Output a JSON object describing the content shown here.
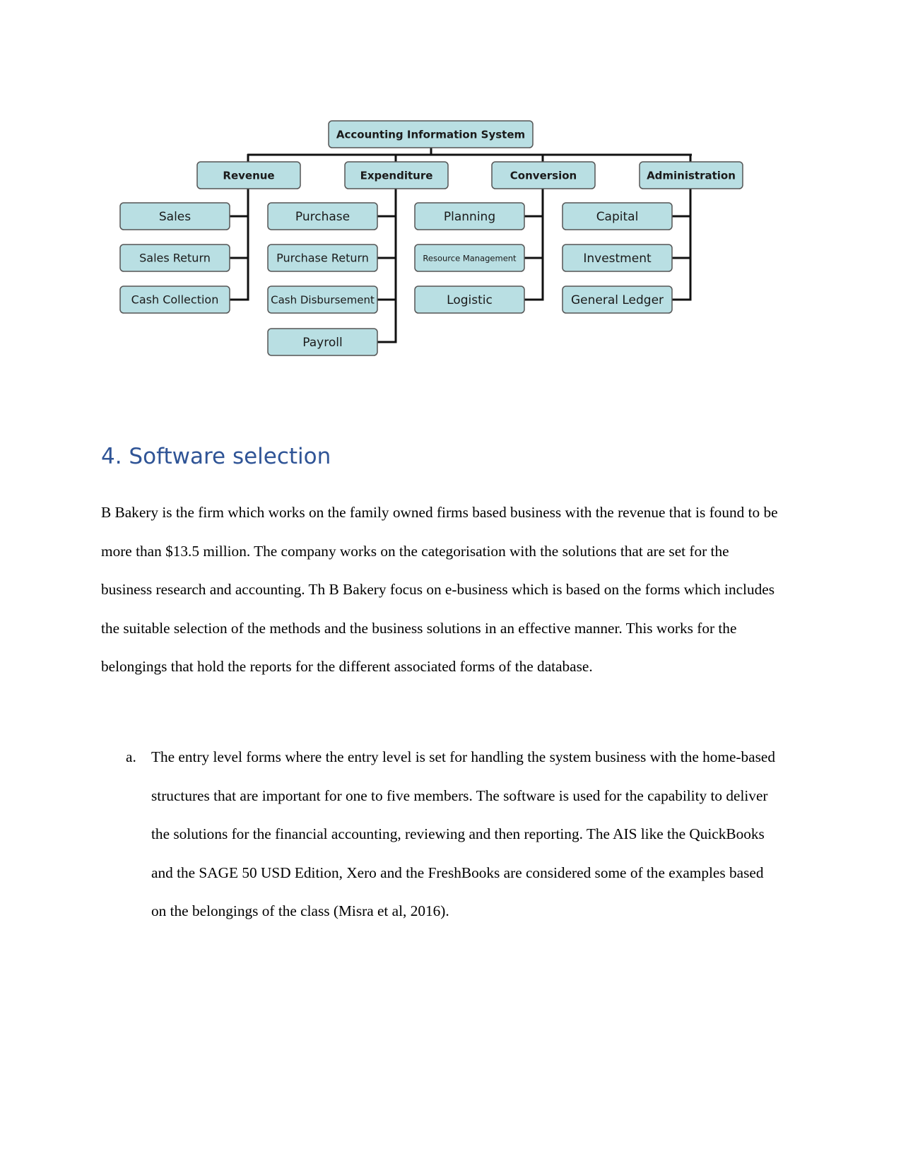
{
  "diagram": {
    "root": "Accounting Information System",
    "fill": "#b9dfe3",
    "categories": [
      {
        "label": "Revenue",
        "children": [
          "Sales",
          "Sales Return",
          "Cash Collection"
        ]
      },
      {
        "label": "Expenditure",
        "children": [
          "Purchase",
          "Purchase Return",
          "Cash Disbursement",
          "Payroll"
        ]
      },
      {
        "label": "Conversion",
        "children": [
          "Planning",
          "Resource Management",
          "Logistic"
        ]
      },
      {
        "label": "Administration",
        "children": [
          "Capital",
          "Investment",
          "General Ledger"
        ]
      }
    ]
  },
  "section": {
    "heading": "4. Software selection",
    "paragraph": "B Bakery is the firm which works on the family owned firms based business with the revenue that is found to be more than $13.5 million. The company works on the categorisation with the solutions that are set for the business research and accounting. Th B Bakery focus on e-business which is based on the forms which includes the suitable selection of the methods and the business solutions in an effective manner. This works for the belongings that hold the reports for the different associated forms of the database.",
    "list": [
      {
        "marker": "a.",
        "text": "The entry level forms where the entry level is set for handling the system business with the home-based structures that are important for one to five members. The software is used for the capability to deliver the solutions for the financial accounting, reviewing and then reporting. The AIS like the QuickBooks and the SAGE 50 USD Edition, Xero and the FreshBooks are considered some of the examples based on the belongings of the class (Misra et al, 2016)."
      }
    ]
  }
}
